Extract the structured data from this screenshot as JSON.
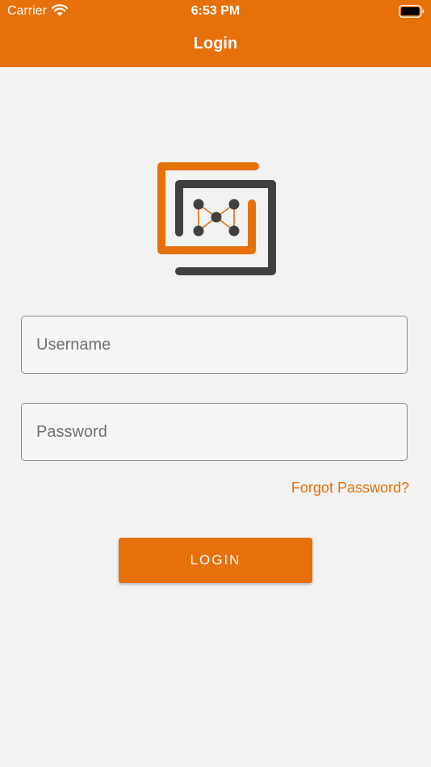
{
  "status_bar": {
    "carrier": "Carrier",
    "time": "6:53 PM"
  },
  "nav": {
    "title": "Login"
  },
  "form": {
    "username_placeholder": "Username",
    "password_placeholder": "Password",
    "forgot_password": "Forgot Password?",
    "login_button": "LOGIN"
  },
  "colors": {
    "accent": "#e6700a",
    "logo_dark": "#404040",
    "background": "#f2f2f2"
  },
  "icons": [
    "wifi-icon",
    "battery-icon",
    "app-logo"
  ]
}
